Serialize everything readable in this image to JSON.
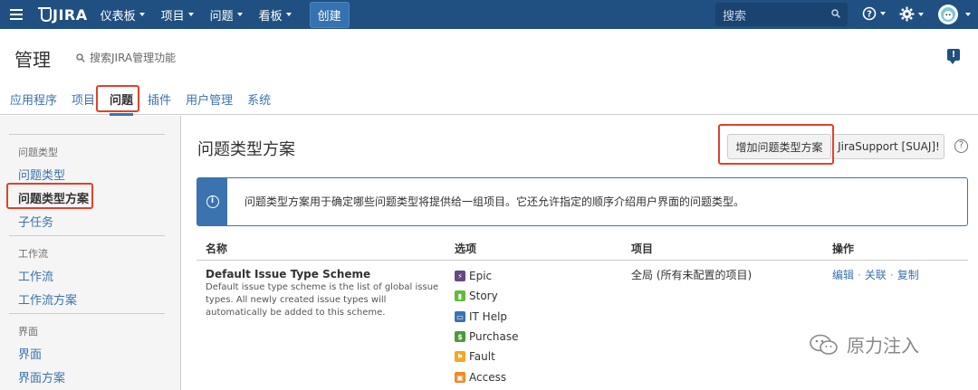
{
  "topnav": {
    "logo": "JIRA",
    "menu": [
      {
        "label": "仪表板"
      },
      {
        "label": "项目"
      },
      {
        "label": "问题"
      },
      {
        "label": "看板"
      }
    ],
    "create_label": "创建",
    "search_placeholder": "搜索"
  },
  "admin": {
    "title": "管理",
    "search_placeholder": "搜索JIRA管理功能"
  },
  "tabs": [
    {
      "label": "应用程序"
    },
    {
      "label": "项目"
    },
    {
      "label": "问题"
    },
    {
      "label": "插件"
    },
    {
      "label": "用户管理"
    },
    {
      "label": "系统"
    }
  ],
  "sidebar": {
    "sections": [
      {
        "heading": "问题类型",
        "items": [
          "问题类型",
          "问题类型方案",
          "子任务"
        ]
      },
      {
        "heading": "工作流",
        "items": [
          "工作流",
          "工作流方案"
        ]
      },
      {
        "heading": "界面",
        "items": [
          "界面",
          "界面方案"
        ]
      }
    ]
  },
  "main": {
    "title": "问题类型方案",
    "add_button": "增加问题类型方案",
    "support_button": "JiraSupport [SUAJ]!",
    "info_text": "问题类型方案用于确定哪些问题类型将提供给一组项目。它还允许指定的顺序介绍用户界面的问题类型。",
    "table": {
      "headers": [
        "名称",
        "选项",
        "项目",
        "操作"
      ],
      "row": {
        "name": "Default Issue Type Scheme",
        "description": "Default issue type scheme is the list of global issue types. All newly created issue types will automatically be added to this scheme.",
        "options": [
          {
            "label": "Epic",
            "color": "#654982",
            "glyph": "⚡"
          },
          {
            "label": "Story",
            "color": "#63ba3c",
            "glyph": "▮"
          },
          {
            "label": "IT Help",
            "color": "#3b73af",
            "glyph": "▭"
          },
          {
            "label": "Purchase",
            "color": "#4a9a3a",
            "glyph": "$"
          },
          {
            "label": "Fault",
            "color": "#f5a623",
            "glyph": "⚑"
          },
          {
            "label": "Access",
            "color": "#f08a24",
            "glyph": "🔒"
          }
        ],
        "project": "全局 (所有未配置的项目)",
        "ops": [
          "编辑",
          "关联",
          "复制"
        ]
      }
    }
  },
  "watermark": "原力注入"
}
